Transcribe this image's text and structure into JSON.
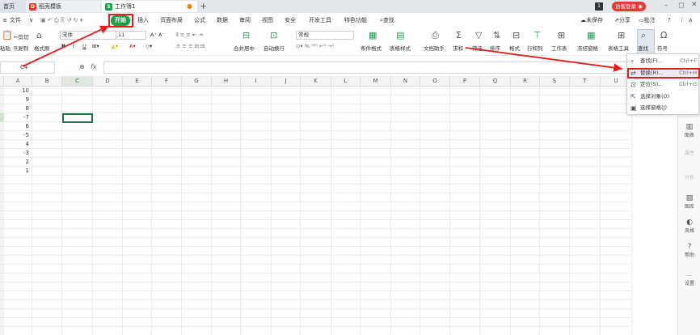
{
  "tabs": {
    "home": "首页",
    "template": "稻壳模板",
    "workbook": "工作簿1",
    "add": "+"
  },
  "titlebar": {
    "page_indicator": "1",
    "login": "访客登录"
  },
  "menu": {
    "file": "文件",
    "start": "开始",
    "insert": "插入",
    "page_layout": "页面布局",
    "formula": "公式",
    "data": "数据",
    "review": "审阅",
    "view": "视图",
    "security": "安全",
    "dev_tools": "开发工具",
    "special": "特色功能",
    "search": "查找",
    "unsaved": "未保存",
    "share": "分享",
    "comment": "批注"
  },
  "ribbon": {
    "cut": "剪切",
    "copy": "复制",
    "format_painter": "格式刷",
    "paste": "粘贴",
    "font_name": "宋体",
    "font_size": "11",
    "number_format": "常规",
    "merge_center": "合并居中",
    "wrap_text": "自动换行",
    "cond_format": "条件格式",
    "table_style": "表格样式",
    "doc_assistant": "文档助手",
    "sum": "求和",
    "filter": "筛选",
    "sort": "排序",
    "format": "格式",
    "row_col": "行和列",
    "worksheet": "工作表",
    "freeze": "冻结窗格",
    "table_tools": "表格工具",
    "find": "查找",
    "symbol": "符号"
  },
  "formula_bar": {
    "cell_ref": "C4",
    "fx": "fx"
  },
  "columns": [
    "A",
    "B",
    "C",
    "D",
    "E",
    "F",
    "G",
    "H",
    "I",
    "J",
    "K",
    "L",
    "M",
    "N",
    "O",
    "P",
    "Q",
    "R",
    "S",
    "T",
    "U"
  ],
  "column_a_values": [
    "10",
    "9",
    "8",
    "-7",
    "6",
    "-5",
    "4",
    "-3",
    "2",
    "1"
  ],
  "dropdown": [
    {
      "label": "查找(F)...",
      "shortcut": "Ctrl+F",
      "icon": "search-icon"
    },
    {
      "label": "替换(R)...",
      "shortcut": "Ctrl+H",
      "icon": "replace-icon"
    },
    {
      "label": "定位(S)...",
      "shortcut": "Ctrl+G",
      "icon": "locate-icon"
    },
    {
      "label": "选择对象(O)",
      "shortcut": "",
      "icon": "cursor-icon"
    },
    {
      "label": "选择窗格(J)",
      "shortcut": "",
      "icon": "pane-icon"
    }
  ],
  "right_panel": {
    "chart": "图表",
    "property": "属性",
    "analysis": "分析",
    "gallery": "图库",
    "style": "风格",
    "help": "帮助",
    "settings": "设置"
  },
  "colors": {
    "start_green": "#1a9f4a",
    "highlight_red": "#e02020",
    "selection_green": "#217346"
  }
}
